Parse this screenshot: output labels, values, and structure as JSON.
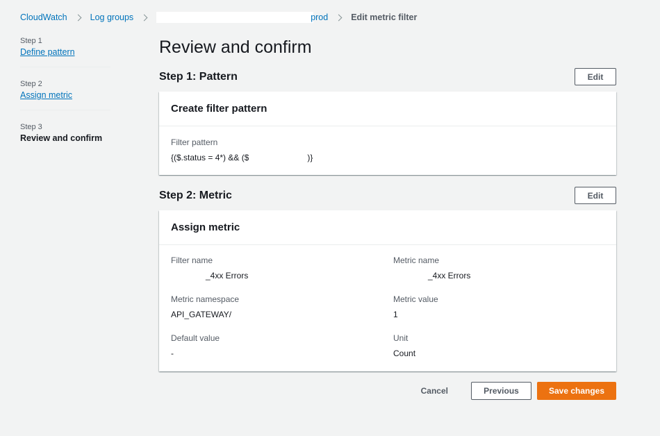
{
  "breadcrumb": {
    "cloudwatch": "CloudWatch",
    "log_groups": "Log groups",
    "log_group_suffix": "prod",
    "current": "Edit metric filter"
  },
  "sidenav": {
    "steps": [
      {
        "num": "Step 1",
        "label": "Define pattern"
      },
      {
        "num": "Step 2",
        "label": "Assign metric"
      },
      {
        "num": "Step 3",
        "label": "Review and confirm"
      }
    ]
  },
  "page": {
    "title": "Review and confirm"
  },
  "step1": {
    "heading": "Step 1: Pattern",
    "edit_label": "Edit",
    "card_title": "Create filter pattern",
    "filter_pattern_label": "Filter pattern",
    "filter_pattern_prefix": "{($.status = 4*) && ($",
    "filter_pattern_suffix": ")}"
  },
  "step2": {
    "heading": "Step 2: Metric",
    "edit_label": "Edit",
    "card_title": "Assign metric",
    "filter_name_label": "Filter name",
    "filter_name_value": "_4xx Errors",
    "metric_name_label": "Metric name",
    "metric_name_value": "_4xx Errors",
    "metric_namespace_label": "Metric namespace",
    "metric_namespace_value": "API_GATEWAY/",
    "metric_value_label": "Metric value",
    "metric_value_value": "1",
    "default_value_label": "Default value",
    "default_value_value": "-",
    "unit_label": "Unit",
    "unit_value": "Count"
  },
  "footer": {
    "cancel_label": "Cancel",
    "previous_label": "Previous",
    "save_label": "Save changes"
  },
  "colors": {
    "link": "#0073bb",
    "primary": "#ec7211",
    "background": "#f2f3f3"
  }
}
